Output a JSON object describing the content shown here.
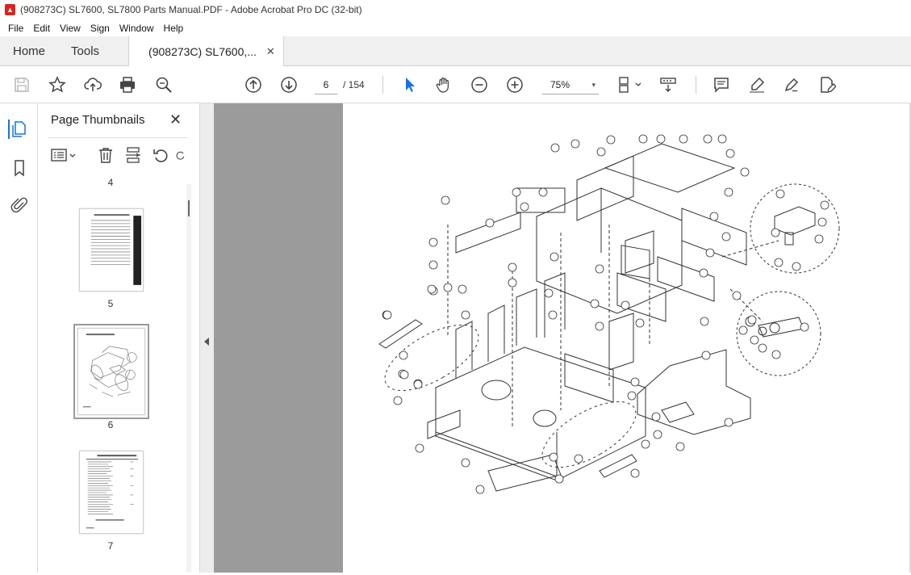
{
  "window": {
    "title": "(908273C) SL7600, SL7800 Parts Manual.PDF - Adobe Acrobat Pro DC (32-bit)",
    "app_icon": "acrobat-icon",
    "accent": "#d9241c"
  },
  "menu": [
    "File",
    "Edit",
    "View",
    "Sign",
    "Window",
    "Help"
  ],
  "tabs": {
    "home": "Home",
    "tools": "Tools",
    "doc": "(908273C) SL7600,...",
    "close": "✕"
  },
  "toolbar": {
    "page_current": "6",
    "page_total": "/ 154",
    "zoom": "75%",
    "zoom_caret": "▾",
    "icons": [
      "save-icon",
      "bookmark-star-icon",
      "upload-icon",
      "print-icon",
      "search-icon",
      "prev-page-icon",
      "next-page-icon",
      "select-cursor-icon",
      "hand-tool-icon",
      "zoom-out-icon",
      "zoom-in-icon",
      "page-fit-icon",
      "scroll-mode-icon",
      "comment-icon",
      "highlight-icon",
      "sign-icon",
      "edit-pdf-icon"
    ]
  },
  "thumbnails": {
    "title": "Page Thumbnails",
    "close": "✕",
    "pages": [
      {
        "label": "4"
      },
      {
        "label": "5"
      },
      {
        "label": "6",
        "selected": true
      },
      {
        "label": "7"
      }
    ]
  },
  "document": {
    "current_page": 6
  }
}
